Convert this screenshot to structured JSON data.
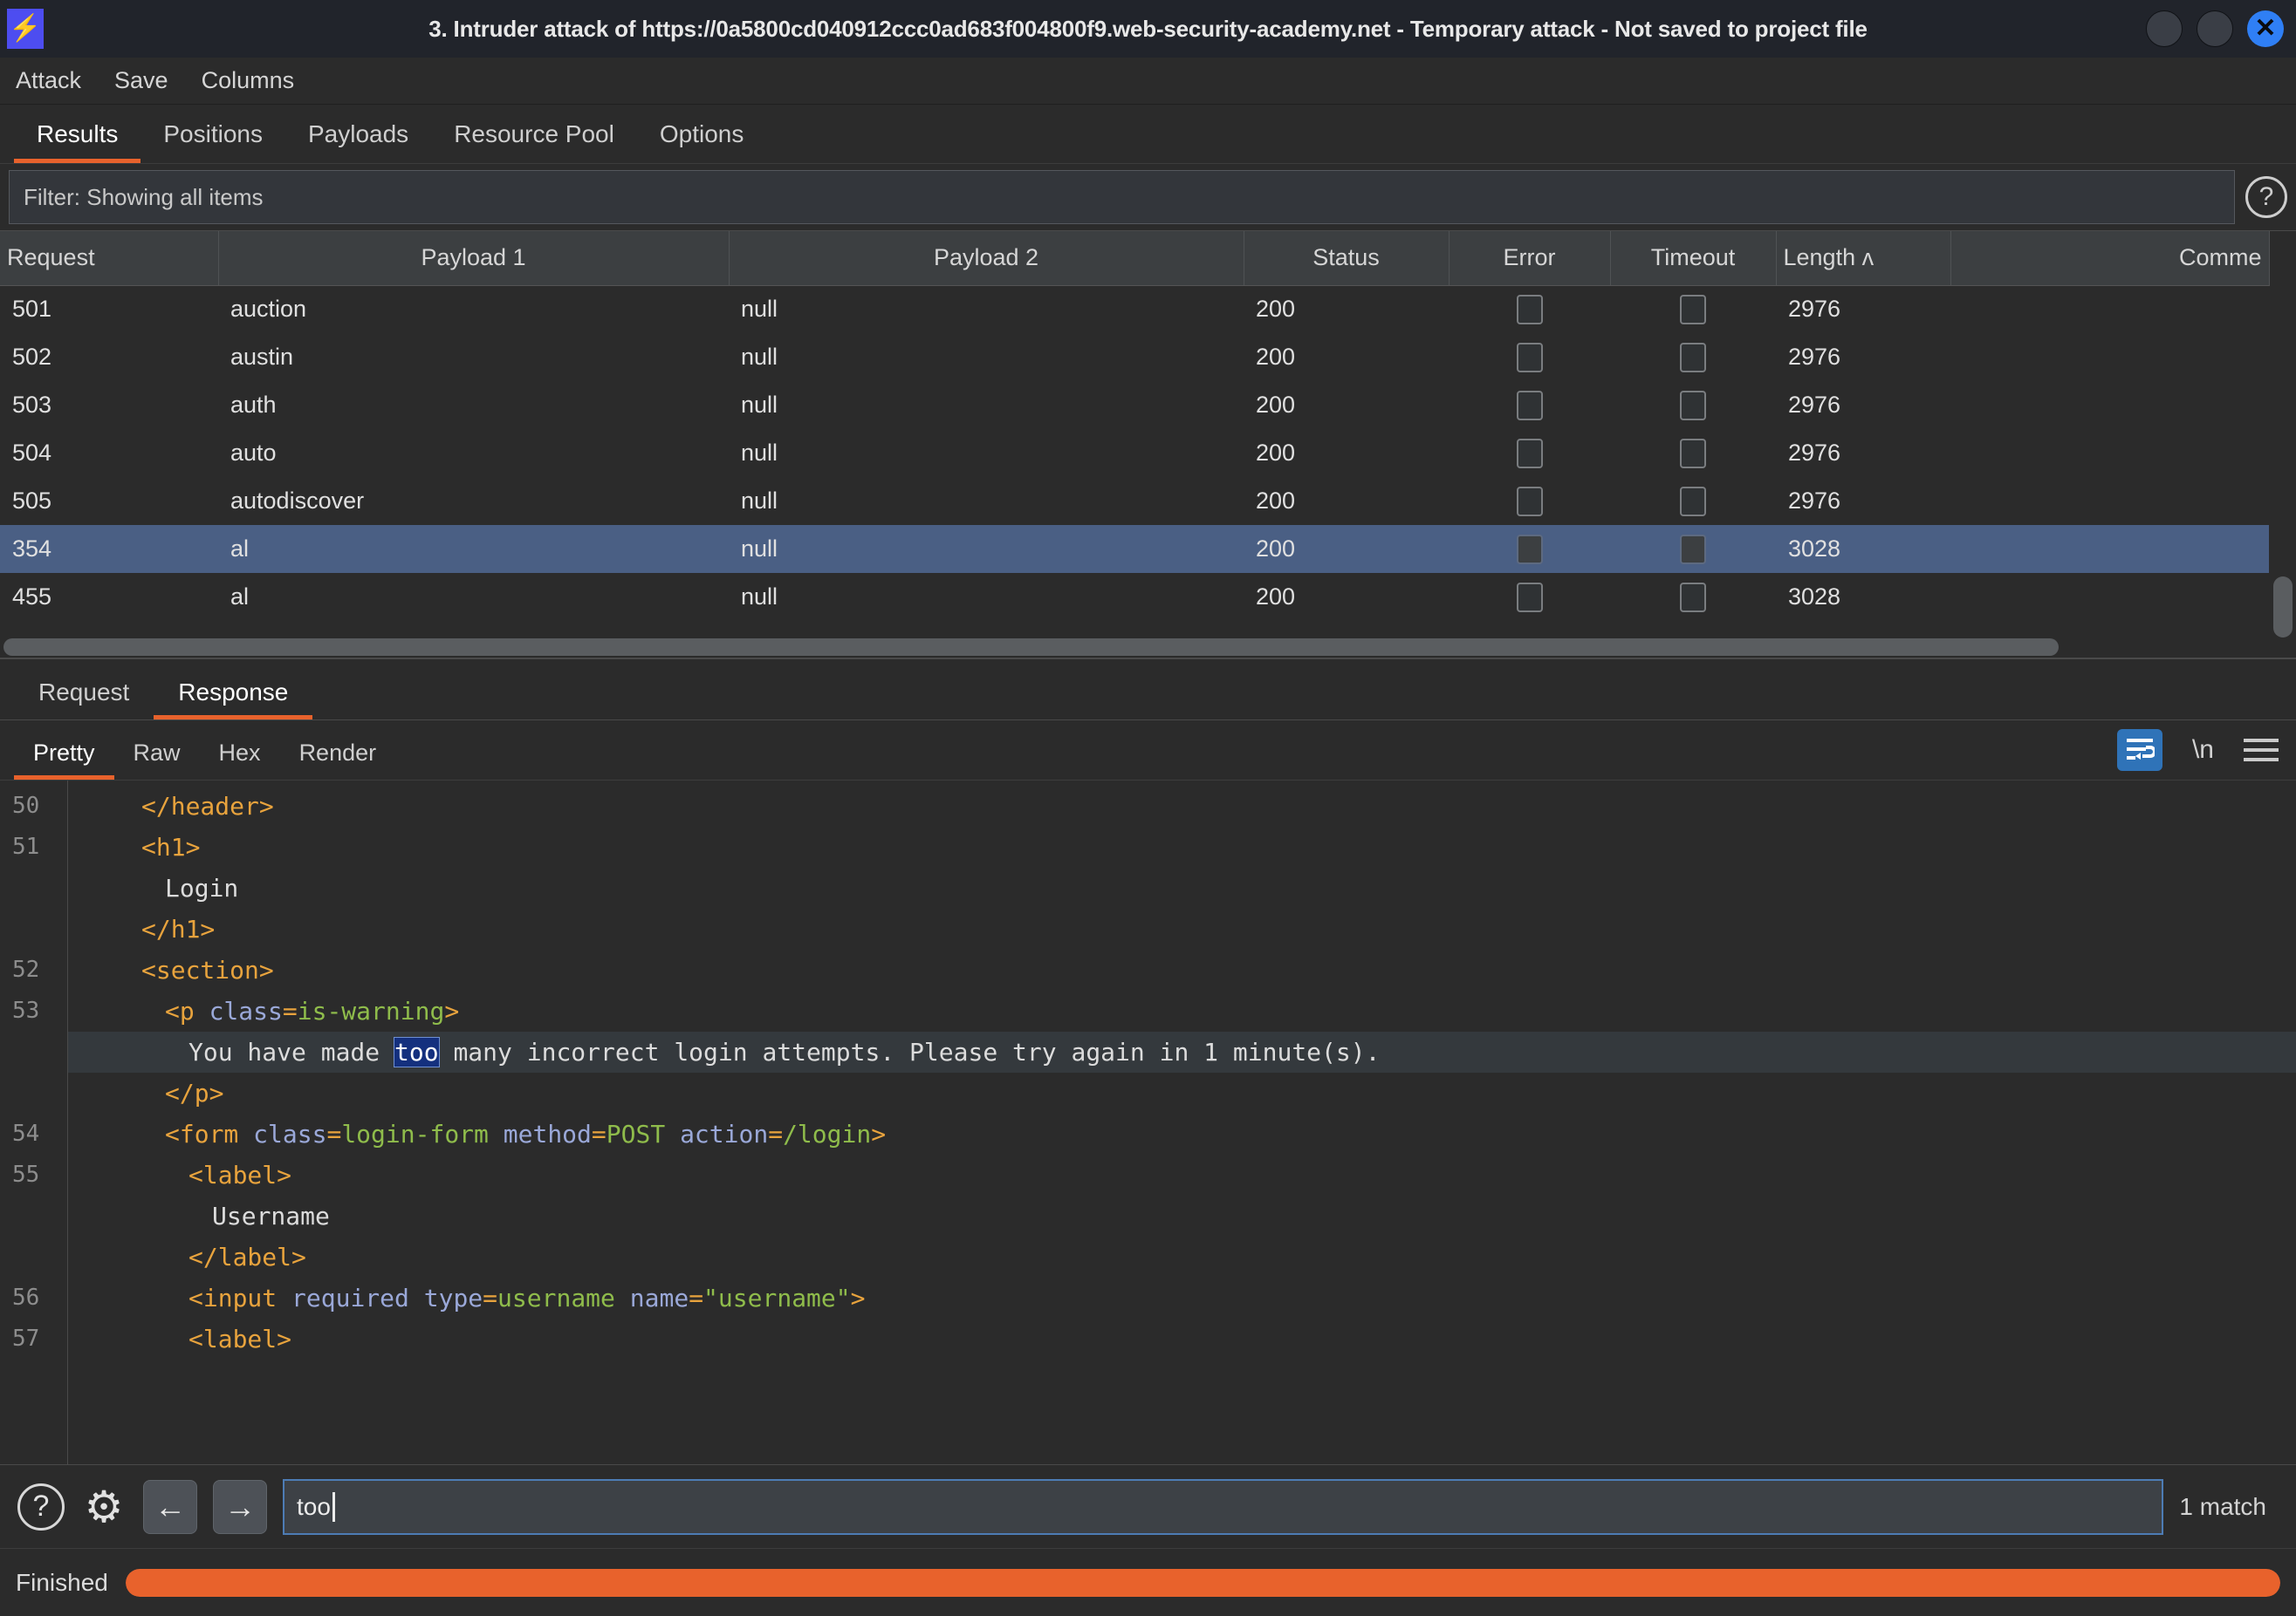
{
  "window": {
    "title": "3. Intruder attack of https://0a5800cd040912ccc0ad683f004800f9.web-security-academy.net - Temporary attack - Not saved to project file",
    "logo_glyph": "⚡",
    "close_glyph": "✕"
  },
  "menu": {
    "items": [
      "Attack",
      "Save",
      "Columns"
    ]
  },
  "main_tabs": {
    "items": [
      "Results",
      "Positions",
      "Payloads",
      "Resource Pool",
      "Options"
    ],
    "active": "Results"
  },
  "filter": {
    "text": "Filter: Showing all items",
    "help_glyph": "?"
  },
  "results_table": {
    "columns": [
      "Request",
      "Payload 1",
      "Payload 2",
      "Status",
      "Error",
      "Timeout",
      "Length ʌ",
      "Comme"
    ],
    "sort_column": "Length",
    "sort_direction": "ascending",
    "rows": [
      {
        "request": "501",
        "payload1": "auction",
        "payload2": "null",
        "status": "200",
        "error": false,
        "timeout": false,
        "length": "2976",
        "comment": "",
        "selected": false
      },
      {
        "request": "502",
        "payload1": "austin",
        "payload2": "null",
        "status": "200",
        "error": false,
        "timeout": false,
        "length": "2976",
        "comment": "",
        "selected": false
      },
      {
        "request": "503",
        "payload1": "auth",
        "payload2": "null",
        "status": "200",
        "error": false,
        "timeout": false,
        "length": "2976",
        "comment": "",
        "selected": false
      },
      {
        "request": "504",
        "payload1": "auto",
        "payload2": "null",
        "status": "200",
        "error": false,
        "timeout": false,
        "length": "2976",
        "comment": "",
        "selected": false
      },
      {
        "request": "505",
        "payload1": "autodiscover",
        "payload2": "null",
        "status": "200",
        "error": false,
        "timeout": false,
        "length": "2976",
        "comment": "",
        "selected": false
      },
      {
        "request": "354",
        "payload1": "al",
        "payload2": "null",
        "status": "200",
        "error": false,
        "timeout": false,
        "length": "3028",
        "comment": "",
        "selected": true
      },
      {
        "request": "455",
        "payload1": "al",
        "payload2": "null",
        "status": "200",
        "error": false,
        "timeout": false,
        "length": "3028",
        "comment": "",
        "selected": false
      }
    ]
  },
  "message_tabs": {
    "items": [
      "Request",
      "Response"
    ],
    "active": "Response"
  },
  "view_tabs": {
    "items": [
      "Pretty",
      "Raw",
      "Hex",
      "Render"
    ],
    "active": "Pretty",
    "tools": {
      "wrap_icon": "word-wrap-icon",
      "newline_label": "\\n",
      "menu_icon": "hamburger-menu-icon"
    }
  },
  "editor": {
    "line_numbers": [
      "50",
      "51",
      "",
      "",
      "52",
      "53",
      "",
      "",
      "54",
      "55",
      "",
      "",
      "56",
      "57"
    ],
    "lines": [
      {
        "num": "50",
        "indent": 2,
        "highlight": false,
        "tokens": [
          {
            "t": "tag",
            "v": "</header>"
          }
        ]
      },
      {
        "num": "51",
        "indent": 2,
        "highlight": false,
        "tokens": [
          {
            "t": "tag",
            "v": "<h1>"
          }
        ]
      },
      {
        "num": "",
        "indent": 3,
        "highlight": false,
        "tokens": [
          {
            "t": "txt",
            "v": "Login"
          }
        ]
      },
      {
        "num": "",
        "indent": 2,
        "highlight": false,
        "tokens": [
          {
            "t": "tag",
            "v": "</h1>"
          }
        ]
      },
      {
        "num": "52",
        "indent": 2,
        "highlight": false,
        "tokens": [
          {
            "t": "tag",
            "v": "<section>"
          }
        ]
      },
      {
        "num": "53",
        "indent": 3,
        "highlight": false,
        "tokens": [
          {
            "t": "tag",
            "v": "<p "
          },
          {
            "t": "attr",
            "v": "class"
          },
          {
            "t": "tag",
            "v": "="
          },
          {
            "t": "val",
            "v": "is-warning"
          },
          {
            "t": "tag",
            "v": ">"
          }
        ]
      },
      {
        "num": "",
        "indent": 4,
        "highlight": true,
        "tokens": [
          {
            "t": "txt",
            "v": "You have made "
          },
          {
            "t": "match",
            "v": "too"
          },
          {
            "t": "txt",
            "v": " many incorrect login attempts. Please try again in 1 minute(s)."
          }
        ]
      },
      {
        "num": "",
        "indent": 3,
        "highlight": false,
        "tokens": [
          {
            "t": "tag",
            "v": "</p>"
          }
        ]
      },
      {
        "num": "54",
        "indent": 3,
        "highlight": false,
        "tokens": [
          {
            "t": "tag",
            "v": "<form "
          },
          {
            "t": "attr",
            "v": "class"
          },
          {
            "t": "tag",
            "v": "="
          },
          {
            "t": "val",
            "v": "login-form"
          },
          {
            "t": "txt",
            "v": " "
          },
          {
            "t": "attr",
            "v": "method"
          },
          {
            "t": "tag",
            "v": "="
          },
          {
            "t": "val",
            "v": "POST"
          },
          {
            "t": "txt",
            "v": " "
          },
          {
            "t": "attr",
            "v": "action"
          },
          {
            "t": "tag",
            "v": "="
          },
          {
            "t": "val",
            "v": "/login"
          },
          {
            "t": "tag",
            "v": ">"
          }
        ]
      },
      {
        "num": "55",
        "indent": 4,
        "highlight": false,
        "tokens": [
          {
            "t": "tag",
            "v": "<label>"
          }
        ]
      },
      {
        "num": "",
        "indent": 5,
        "highlight": false,
        "tokens": [
          {
            "t": "txt",
            "v": "Username"
          }
        ]
      },
      {
        "num": "",
        "indent": 4,
        "highlight": false,
        "tokens": [
          {
            "t": "tag",
            "v": "</label>"
          }
        ]
      },
      {
        "num": "56",
        "indent": 4,
        "highlight": false,
        "tokens": [
          {
            "t": "tag",
            "v": "<input "
          },
          {
            "t": "attr",
            "v": "required"
          },
          {
            "t": "txt",
            "v": " "
          },
          {
            "t": "attr",
            "v": "type"
          },
          {
            "t": "tag",
            "v": "="
          },
          {
            "t": "val",
            "v": "username"
          },
          {
            "t": "txt",
            "v": " "
          },
          {
            "t": "attr",
            "v": "name"
          },
          {
            "t": "tag",
            "v": "="
          },
          {
            "t": "val",
            "v": "\"username\""
          },
          {
            "t": "tag",
            "v": ">"
          }
        ]
      },
      {
        "num": "57",
        "indent": 4,
        "highlight": false,
        "tokens": [
          {
            "t": "tag",
            "v": "<label>"
          }
        ]
      }
    ]
  },
  "search": {
    "help_glyph": "?",
    "gear_glyph": "⚙",
    "prev_glyph": "←",
    "next_glyph": "→",
    "value": "too",
    "match_count": "1 match"
  },
  "status": {
    "label": "Finished",
    "progress_percent": 100,
    "progress_color": "#e8622c"
  }
}
